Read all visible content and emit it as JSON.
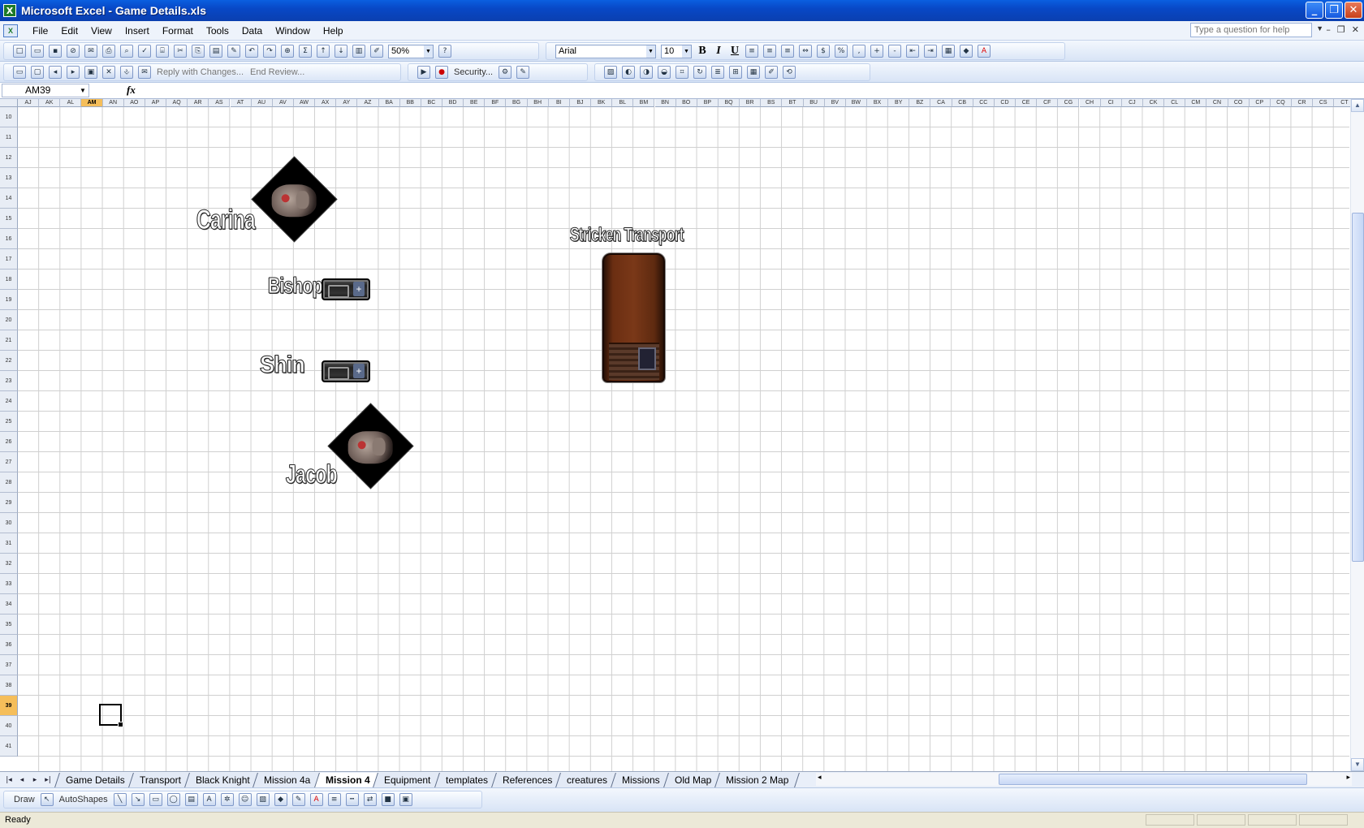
{
  "window": {
    "title": "Microsoft Excel - Game Details.xls",
    "app_icon": "X"
  },
  "window_controls": [
    {
      "name": "minimize",
      "glyph": "_"
    },
    {
      "name": "restore",
      "glyph": "❐"
    },
    {
      "name": "close",
      "glyph": "✕"
    }
  ],
  "menu": [
    "File",
    "Edit",
    "View",
    "Insert",
    "Format",
    "Tools",
    "Data",
    "Window",
    "Help"
  ],
  "help_box": {
    "placeholder": "Type a question for help"
  },
  "standard_toolbar": {
    "zoom": "50%",
    "font": "Arial",
    "size": "10"
  },
  "reviewing_toolbar": {
    "reply": "Reply with Changes...",
    "end_review": "End Review...",
    "security": "Security..."
  },
  "formula_bar": {
    "name_box": "AM39",
    "fx": "fx",
    "content": ""
  },
  "columns": [
    "AJ",
    "AK",
    "AL",
    "AM",
    "AN",
    "AO",
    "AP",
    "AQ",
    "AR",
    "AS",
    "AT",
    "AU",
    "AV",
    "AW",
    "AX",
    "AY",
    "AZ",
    "BA",
    "BB",
    "BC",
    "BD",
    "BE",
    "BF",
    "BG",
    "BH",
    "BI",
    "BJ",
    "BK",
    "BL",
    "BM",
    "BN",
    "BO",
    "BP",
    "BQ",
    "BR",
    "BS",
    "BT",
    "BU",
    "BV",
    "BW",
    "BX",
    "BY",
    "BZ",
    "CA",
    "CB",
    "CC",
    "CD",
    "CE",
    "CF",
    "CG",
    "CH",
    "CI",
    "CJ",
    "CK",
    "CL",
    "CM",
    "CN",
    "CO",
    "CP",
    "CQ",
    "CR",
    "CS",
    "CT"
  ],
  "selected_column": "AM",
  "rows": [
    "10",
    "11",
    "12",
    "13",
    "14",
    "15",
    "16",
    "17",
    "18",
    "19",
    "20",
    "21",
    "22",
    "23",
    "24",
    "25",
    "26",
    "27",
    "28",
    "29",
    "30",
    "31",
    "32",
    "33",
    "34",
    "35",
    "36",
    "37",
    "38",
    "39",
    "40",
    "41"
  ],
  "selected_row": "39",
  "map": {
    "carina": "Carina",
    "bishop": "Bishop",
    "shin": "Shin",
    "jacob": "Jacob",
    "transport": "Stricken Transport"
  },
  "sheet_tabs": [
    "Game Details",
    "Transport",
    "Black Knight",
    "Mission 4a",
    "Mission 4",
    "Equipment",
    "templates",
    "References",
    "creatures",
    "Missions",
    "Old Map",
    "Mission 2 Map"
  ],
  "active_tab": "Mission 4",
  "draw_toolbar": {
    "draw": "Draw",
    "autoshapes": "AutoShapes"
  },
  "status": "Ready"
}
